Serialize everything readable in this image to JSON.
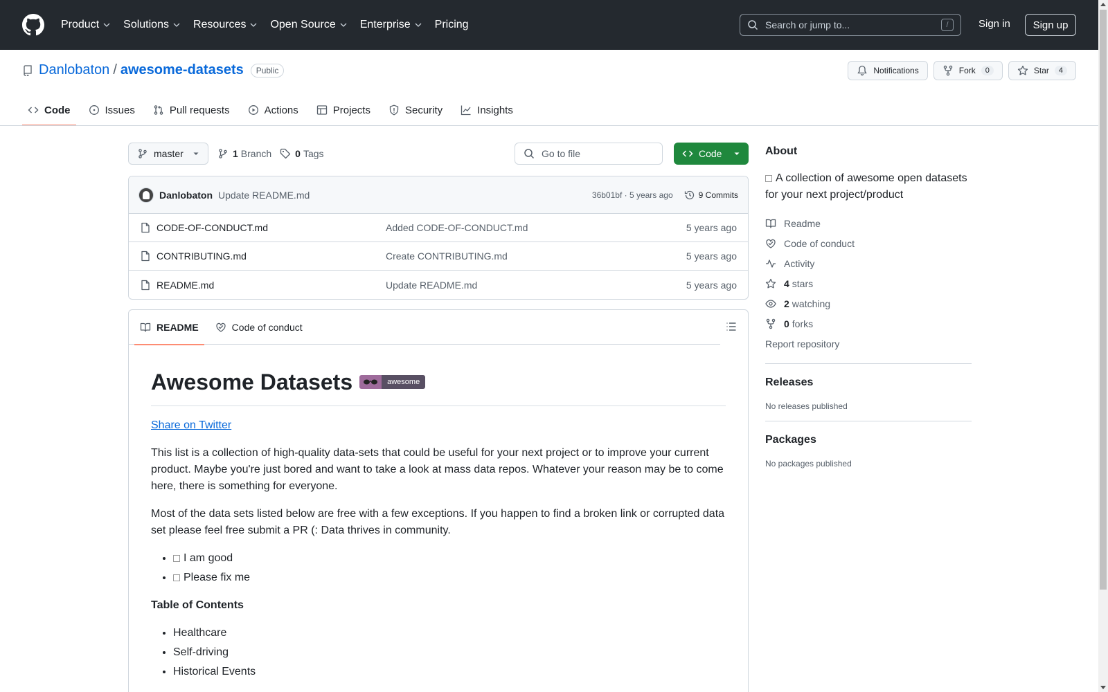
{
  "header": {
    "nav": [
      "Product",
      "Solutions",
      "Resources",
      "Open Source",
      "Enterprise",
      "Pricing"
    ],
    "search_placeholder": "Search or jump to...",
    "search_shortcut": "/",
    "sign_in": "Sign in",
    "sign_up": "Sign up"
  },
  "repo": {
    "owner": "Danlobaton",
    "separator": "/",
    "name": "awesome-datasets",
    "visibility": "Public",
    "notifications_label": "Notifications",
    "fork_label": "Fork",
    "fork_count": "0",
    "star_label": "Star",
    "star_count": "4"
  },
  "tabs": [
    "Code",
    "Issues",
    "Pull requests",
    "Actions",
    "Projects",
    "Security",
    "Insights"
  ],
  "branch": {
    "name": "master",
    "branch_count": "1",
    "branch_label": "Branch",
    "tag_count": "0",
    "tag_label": "Tags",
    "goto_placeholder": "Go to file",
    "code_label": "Code"
  },
  "latest_commit": {
    "author": "Danlobaton",
    "message": "Update README.md",
    "hash_age": "36b01bf · 5 years ago",
    "commits": "9 Commits"
  },
  "files": [
    {
      "name": "CODE-OF-CONDUCT.md",
      "commit": "Added CODE-OF-CONDUCT.md",
      "age": "5 years ago"
    },
    {
      "name": "CONTRIBUTING.md",
      "commit": "Create CONTRIBUTING.md",
      "age": "5 years ago"
    },
    {
      "name": "README.md",
      "commit": "Update README.md",
      "age": "5 years ago"
    }
  ],
  "readme": {
    "tab_readme": "README",
    "tab_conduct": "Code of conduct",
    "title": "Awesome Datasets",
    "badge_text": "awesome",
    "share_link": "Share on Twitter",
    "para1": "This list is a collection of high-quality data-sets that could be useful for your next project or to improve your current product. Maybe you're just bored and want to take a look at mass data repos. Whatever your reason may be to come here, there is something for everyone.",
    "para2": "Most of the data sets listed below are free with a few exceptions. If you happen to find a broken link or corrupted data set please feel free submit a PR (: Data thrives in community.",
    "legend": [
      "I am good",
      "Please fix me"
    ],
    "toc_title": "Table of Contents",
    "toc": [
      "Healthcare",
      "Self-driving",
      "Historical Events"
    ]
  },
  "about": {
    "title": "About",
    "description": "A collection of awesome open datasets for your next project/product",
    "readme": "Readme",
    "conduct": "Code of conduct",
    "activity": "Activity",
    "stars_count": "4",
    "stars_label": "stars",
    "watching_count": "2",
    "watching_label": "watching",
    "forks_count": "0",
    "forks_label": "forks",
    "report": "Report repository"
  },
  "releases": {
    "title": "Releases",
    "empty": "No releases published"
  },
  "packages": {
    "title": "Packages",
    "empty": "No packages published"
  },
  "colors": {
    "header_bg": "#24292f",
    "link": "#0969da",
    "primary_btn": "#1f883d",
    "tab_underline": "#fd8c73"
  }
}
